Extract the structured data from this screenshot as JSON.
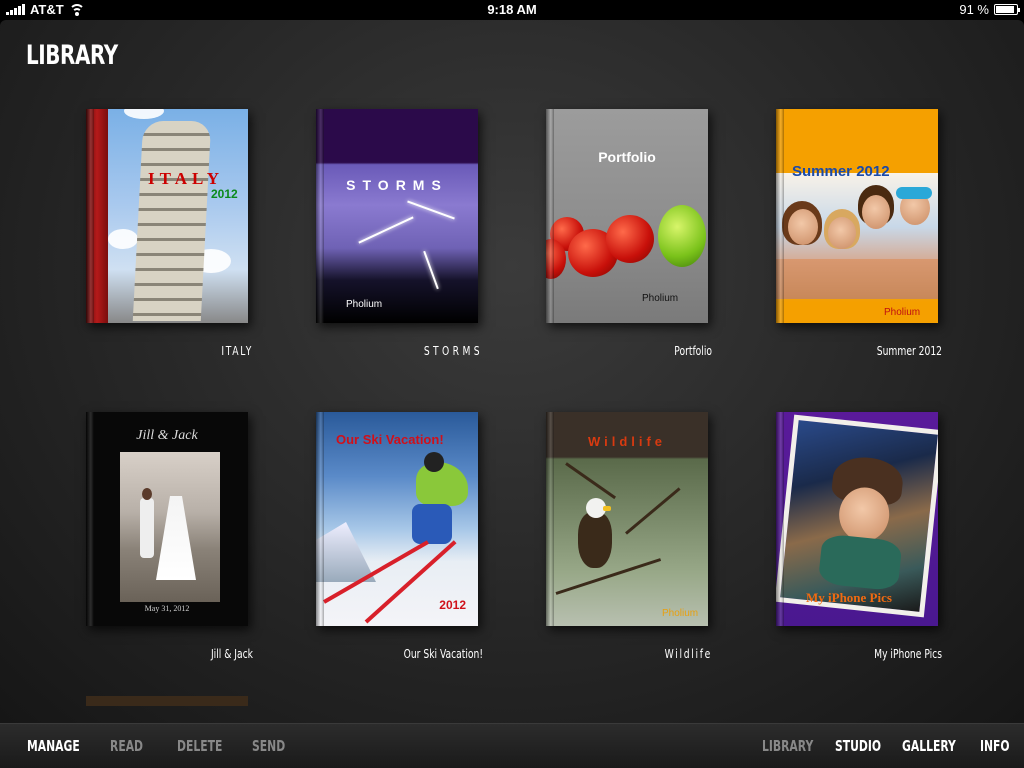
{
  "status": {
    "carrier": "AT&T",
    "time": "9:18 AM",
    "battery": "91 %",
    "battery_level": 0.91
  },
  "library": {
    "title": "LIBRARY"
  },
  "books": [
    {
      "id": "italy",
      "caption": "ITALY",
      "cover_title": "ITALY",
      "cover_sub": "2012"
    },
    {
      "id": "storms",
      "caption": "STORMS",
      "cover_title": "STORMS",
      "brand": "Pholium"
    },
    {
      "id": "portfolio",
      "caption": "Portfolio",
      "cover_title": "Portfolio",
      "brand": "Pholium"
    },
    {
      "id": "summer",
      "caption": "Summer 2012",
      "cover_title": "Summer 2012",
      "brand": "Pholium"
    },
    {
      "id": "jill",
      "caption": "Jill & Jack",
      "cover_title": "Jill & Jack",
      "cover_date": "May 31, 2012"
    },
    {
      "id": "ski",
      "caption": "Our Ski Vacation!",
      "cover_title": "Our Ski Vacation!",
      "cover_sub": "2012"
    },
    {
      "id": "wildlife",
      "caption": "Wildlife",
      "cover_title": "Wildlife",
      "brand": "Pholium"
    },
    {
      "id": "iphone",
      "caption": "My iPhone Pics",
      "cover_title": "My iPhone Pics"
    }
  ],
  "toolbar": {
    "left": [
      {
        "label": "MANAGE",
        "active": true
      },
      {
        "label": "READ",
        "active": false
      },
      {
        "label": "DELETE",
        "active": false
      },
      {
        "label": "SEND",
        "active": false
      }
    ],
    "right": [
      {
        "label": "LIBRARY",
        "active": false
      },
      {
        "label": "STUDIO",
        "active": true
      },
      {
        "label": "GALLERY",
        "active": true
      },
      {
        "label": "INFO",
        "active": true
      }
    ]
  }
}
